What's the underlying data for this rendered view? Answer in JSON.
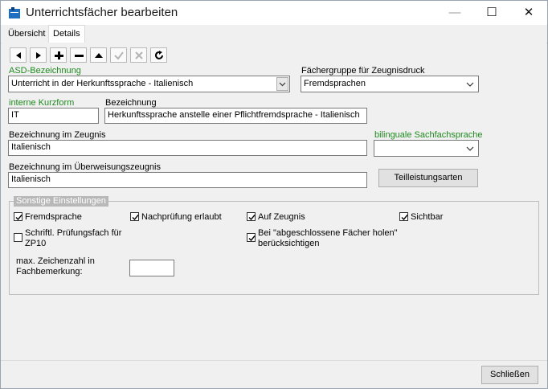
{
  "window": {
    "title": "Unterrichtsfächer bearbeiten",
    "minimize_glyph": "—",
    "maximize_glyph": "☐",
    "close_glyph": "✕"
  },
  "tabs": [
    {
      "label": "Übersicht",
      "active": false
    },
    {
      "label": "Details",
      "active": true
    }
  ],
  "toolbar": {
    "buttons": [
      "prev-icon",
      "next-icon",
      "add-icon",
      "remove-icon",
      "up-icon",
      "check-icon",
      "cancel-icon",
      "refresh-icon"
    ]
  },
  "form": {
    "asd_label": "ASD-Bezeichnung",
    "asd_value": "Unterricht in der Herkunftssprache - Italienisch",
    "gruppe_label": "Fächergruppe für Zeugnisdruck",
    "gruppe_value": "Fremdsprachen",
    "kurzform_label": "interne Kurzform",
    "kurzform_value": "IT",
    "bezeichnung_label": "Bezeichnung",
    "bezeichnung_value": "Herkunftssprache anstelle einer Pflichtfremdsprache - Italienisch",
    "zeugnis_label": "Bezeichnung im Zeugnis",
    "zeugnis_value": "Italienisch",
    "bilingual_label": "bilinguale Sachfachsprache",
    "bilingual_value": "",
    "ueberweisung_label": "Bezeichnung im Überweisungszeugnis",
    "ueberweisung_value": "Italienisch",
    "teilleistung_button": "Teilleistungsarten"
  },
  "settings": {
    "title": "Sonstige Einstellungen",
    "fremdsprache": {
      "label": "Fremdsprache",
      "checked": true
    },
    "nachpruefung": {
      "label": "Nachprüfung erlaubt",
      "checked": true
    },
    "auf_zeugnis": {
      "label": "Auf Zeugnis",
      "checked": true
    },
    "sichtbar": {
      "label": "Sichtbar",
      "checked": true
    },
    "schriftl_line1": "Schriftl. Prüfungsfach für",
    "schriftl_line2": "ZP10",
    "schriftl_checked": false,
    "abgeschlossen_line1": "Bei \"abgeschlossene Fächer holen\"",
    "abgeschlossen_line2": "berücksichtigen",
    "abgeschlossen_checked": true,
    "zeichen_line1": "max. Zeichenzahl in",
    "zeichen_line2": "Fachbemerkung:",
    "zeichen_value": ""
  },
  "footer": {
    "close_button": "Schließen"
  },
  "colors": {
    "accent_green": "#1f8a1f",
    "window_bg": "#f0f0f0"
  }
}
